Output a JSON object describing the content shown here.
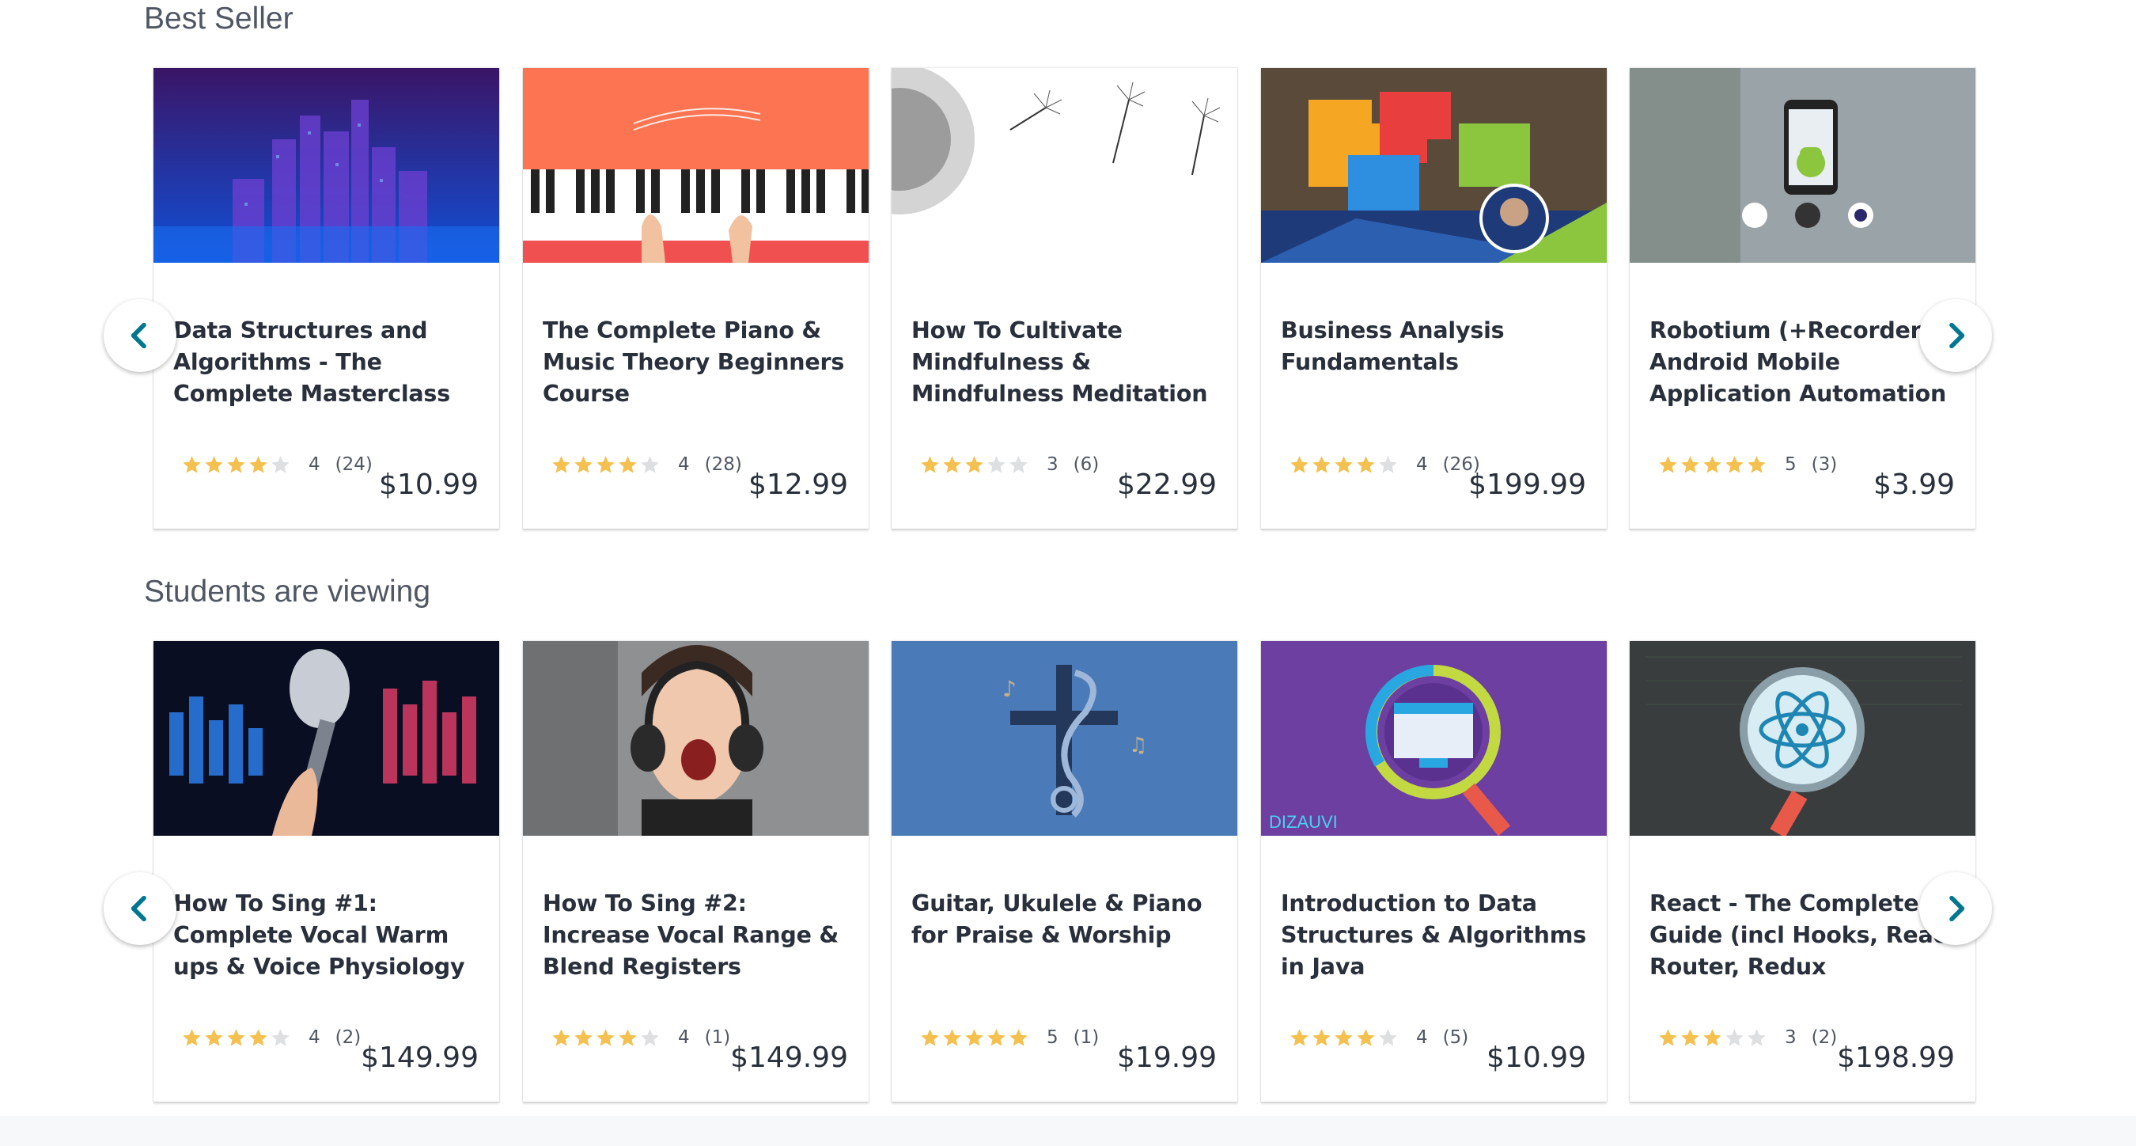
{
  "sections": [
    {
      "title": "Best Seller",
      "courses": [
        {
          "title": "Data Structures and Algorithms - The Complete Masterclass",
          "rating": 4,
          "rating_label": "4",
          "reviews": "(24)",
          "price": "$10.99",
          "thumb": "city-skyline-image"
        },
        {
          "title": "The Complete Piano & Music Theory Beginners Course",
          "rating": 4,
          "rating_label": "4",
          "reviews": "(28)",
          "price": "$12.99",
          "thumb": "piano-keys-image"
        },
        {
          "title": "How To Cultivate Mindfulness & Mindfulness Meditation",
          "rating": 3,
          "rating_label": "3",
          "reviews": "(6)",
          "price": "$22.99",
          "thumb": "dandelion-seeds-image"
        },
        {
          "title": "Business Analysis Fundamentals",
          "rating": 4,
          "rating_label": "4",
          "reviews": "(26)",
          "price": "$199.99",
          "thumb": "puzzle-pieces-image"
        },
        {
          "title": "Robotium (+Recorder) - Android Mobile Application Automation",
          "rating": 5,
          "rating_label": "5",
          "reviews": "(3)",
          "price": "$3.99",
          "thumb": "android-phone-image"
        }
      ]
    },
    {
      "title": "Students are viewing",
      "courses": [
        {
          "title": "How To Sing #1: Complete Vocal Warm ups & Voice Physiology",
          "rating": 4,
          "rating_label": "4",
          "reviews": "(2)",
          "price": "$149.99",
          "thumb": "microphone-image"
        },
        {
          "title": "How To Sing #2: Increase Vocal Range & Blend Registers",
          "rating": 4,
          "rating_label": "4",
          "reviews": "(1)",
          "price": "$149.99",
          "thumb": "singer-headphones-image"
        },
        {
          "title": "Guitar, Ukulele & Piano for Praise & Worship",
          "rating": 5,
          "rating_label": "5",
          "reviews": "(1)",
          "price": "$19.99",
          "thumb": "treble-clef-cross-image"
        },
        {
          "title": "Introduction to Data Structures & Algorithms in Java",
          "rating": 4,
          "rating_label": "4",
          "reviews": "(5)",
          "price": "$10.99",
          "thumb": "magnifier-computer-image",
          "thumb_brand": "DIZAUVI"
        },
        {
          "title": "React - The Complete Guide (incl Hooks, React Router, Redux",
          "rating": 3,
          "rating_label": "3",
          "reviews": "(2)",
          "price": "$198.99",
          "thumb": "react-magnifier-image"
        }
      ]
    }
  ],
  "colors": {
    "star": "#f4c150",
    "star_empty": "#dedfe0",
    "arrow": "#007791"
  },
  "icons": {
    "prev": "chevron-left-icon",
    "next": "chevron-right-icon",
    "rating": "star-icon"
  }
}
